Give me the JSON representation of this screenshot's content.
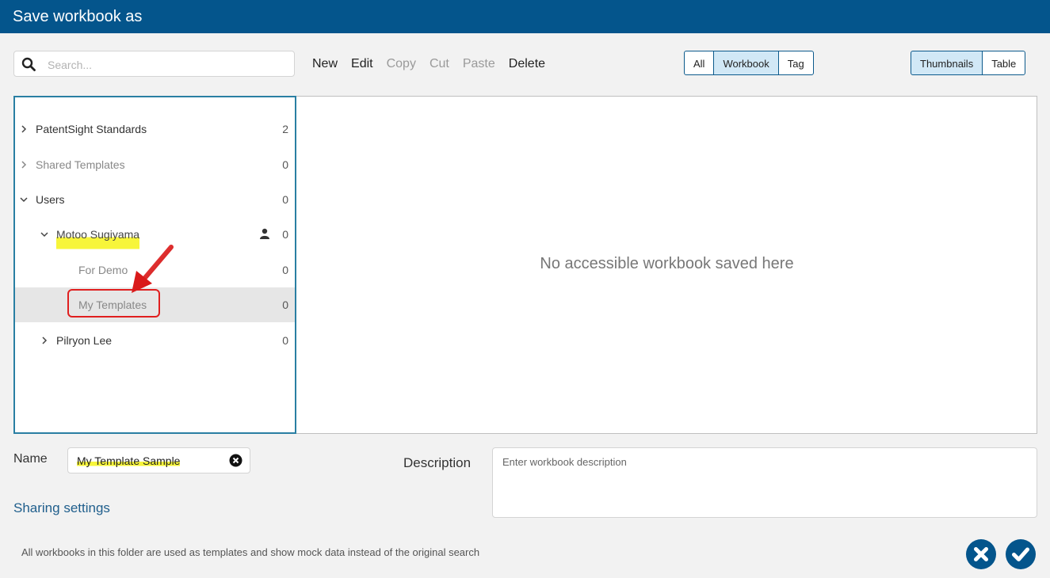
{
  "window": {
    "title": "Save workbook as"
  },
  "search": {
    "placeholder": "Search...",
    "value": ""
  },
  "toolbar": {
    "new": "New",
    "edit": "Edit",
    "copy": "Copy",
    "cut": "Cut",
    "paste": "Paste",
    "delete": "Delete"
  },
  "filter": {
    "all": "All",
    "workbook": "Workbook",
    "tag": "Tag",
    "selected": "Workbook"
  },
  "view": {
    "thumbnails": "Thumbnails",
    "table": "Table",
    "selected": "Thumbnails"
  },
  "tree": {
    "items": [
      {
        "label": "PatentSight Standards",
        "count": "2",
        "expanded": false
      },
      {
        "label": "Shared Templates",
        "count": "0",
        "expanded": false
      },
      {
        "label": "Users",
        "count": "0",
        "expanded": true
      },
      {
        "label": "Motoo Sugiyama",
        "count": "0",
        "expanded": true,
        "icon": "user-icon"
      },
      {
        "label": "For Demo",
        "count": "0"
      },
      {
        "label": "My Templates",
        "count": "0",
        "selected": true
      },
      {
        "label": "Pilryon Lee",
        "count": "0",
        "expanded": false
      }
    ]
  },
  "content": {
    "empty_message": "No accessible workbook saved here"
  },
  "form": {
    "name_label": "Name",
    "name_value": "My Template Sample",
    "description_label": "Description",
    "description_placeholder": "Enter workbook description",
    "sharing_settings": "Sharing settings"
  },
  "footer": {
    "note": "All workbooks in this folder are used as templates and show mock data instead of the original search"
  },
  "colors": {
    "titlebar": "#04558c",
    "accent": "#0c5a8c",
    "highlight": "#f7f53a",
    "annotation": "#e01f1f"
  }
}
